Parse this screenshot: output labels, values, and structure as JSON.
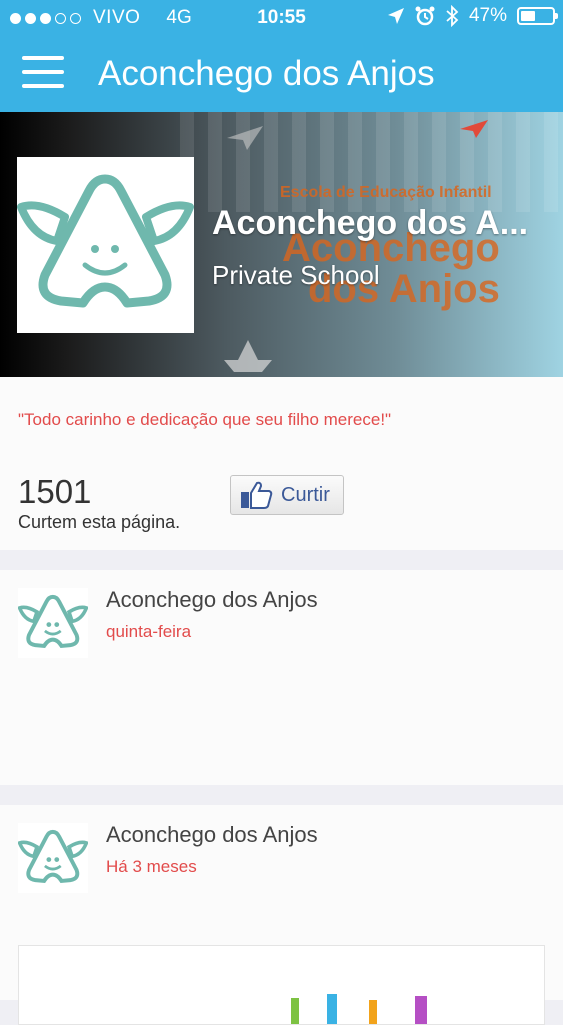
{
  "status_bar": {
    "carrier": "VIVO",
    "network": "4G",
    "time": "10:55",
    "battery": "47%",
    "battery_level": 0.47
  },
  "nav": {
    "title": "Aconchego dos Anjos"
  },
  "cover": {
    "tagline": "Escola de Educação Infantil",
    "logo_text_line1": "Aconchego",
    "logo_text_line2": "dos Anjos",
    "page_name": "Aconchego dos A...",
    "category": "Private School"
  },
  "about": {
    "quote": "\"Todo carinho e dedicação que seu filho merece!\"",
    "likes_count": "1501",
    "likes_label": "Curtem esta página.",
    "like_button": "Curtir"
  },
  "posts": [
    {
      "author": "Aconchego dos Anjos",
      "time": "quinta-feira"
    },
    {
      "author": "Aconchego dos Anjos",
      "time": "Há 3 meses"
    }
  ],
  "colors": {
    "nav_bg": "#3ab2e4",
    "accent_red": "#e24b4b",
    "logo_teal": "#6fb8ad",
    "facebook_blue": "#3b5998"
  }
}
